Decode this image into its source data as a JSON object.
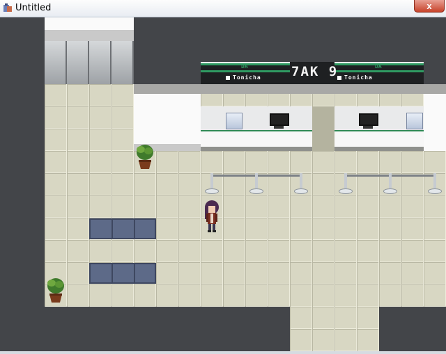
{
  "window": {
    "title": "Untitled",
    "close_label": "x"
  },
  "scene": {
    "sign_left": {
      "logo": "DA",
      "text": "Tonicha"
    },
    "sign_right": {
      "logo": "DA",
      "text": "Tonicha"
    },
    "led_display": "7AK 9"
  },
  "colors": {
    "floor": "#d8d7c3",
    "background": "#434549",
    "accent_green": "#2f9a62",
    "bench": "#5d6a88"
  },
  "icons": {
    "app": "game-window-icon",
    "plant": "potted-plant-icon",
    "character": "player-character-sprite"
  }
}
